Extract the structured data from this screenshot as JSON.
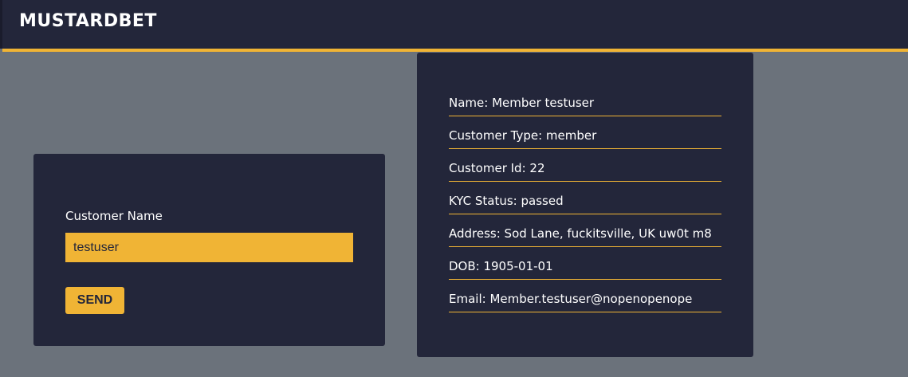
{
  "header": {
    "logo": "MUSTARDBET"
  },
  "form": {
    "label": "Customer Name",
    "input_value": "testuser",
    "send_label": "SEND"
  },
  "customer_info": {
    "name": "Name: Member testuser",
    "type": "Customer Type: member",
    "id": "Customer Id: 22",
    "kyc": "KYC Status: passed",
    "address": "Address: Sod Lane, fuckitsville, UK uw0t m8",
    "dob": "DOB: 1905-01-01",
    "email": "Email: Member.testuser@nopenopenope"
  },
  "colors": {
    "accent": "#f0b435",
    "panel": "#23263a",
    "background": "#6b727b"
  }
}
